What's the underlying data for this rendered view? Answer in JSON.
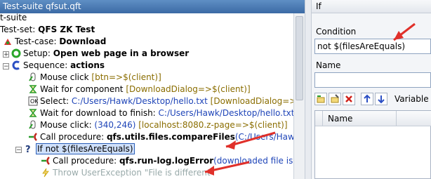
{
  "left_panel": {
    "title": "Test-suite qfsut.qft",
    "tree": [
      {
        "id": "suite",
        "text": "t-suite"
      },
      {
        "id": "set",
        "prefix": "Test-set: ",
        "bold": "QFS ZK Test"
      },
      {
        "id": "case",
        "prefix": "Test-case: ",
        "bold": "Download"
      },
      {
        "id": "setup",
        "prefix": "Setup: ",
        "bold": "Open web page in a browser"
      },
      {
        "id": "seq",
        "prefix": "Sequence: ",
        "bold": "actions"
      },
      {
        "id": "click1",
        "prefix": "Mouse click ",
        "arg": "[btn=>$(client)]"
      },
      {
        "id": "wait",
        "prefix": "Wait for component ",
        "arg": "[DownloadDialog=>$(client)]"
      },
      {
        "id": "select",
        "prefix": "Select: ",
        "arg": "C:/Users/Hawk/Desktop/hello.txt",
        "arg2": " [DownloadDialog=>$"
      },
      {
        "id": "waitdl",
        "prefix": "Wait for download to finish: ",
        "arg": "C:/Users/Hawk/Desktop/hello.txt"
      },
      {
        "id": "click2",
        "prefix": "Mouse click: ",
        "arg": "(340,246)",
        "arg2": " [localhost:8080.z-page=>$(client)]"
      },
      {
        "id": "call1",
        "prefix": "Call procedure: ",
        "bold": "qfs.utils.files.compareFiles",
        "arg": "(C:/Users/Hawk/Des"
      },
      {
        "id": "if",
        "text": "If not $(filesAreEquals)"
      },
      {
        "id": "call2",
        "prefix": "Call procedure: ",
        "bold": "qfs.run-log.logError",
        "arg": "(downloaded file is d"
      },
      {
        "id": "throw",
        "text": "Throw UserException \"File is different\""
      }
    ]
  },
  "right_panel": {
    "title": "If",
    "condition_label": "Condition",
    "condition_value": "not $(filesAreEquals)",
    "name_label": "Name",
    "name_value": "",
    "variable_label": "Variable",
    "table_header_name": "Name"
  },
  "colors": {
    "title_bar": "#3b6aa5",
    "link_blue": "#1f45b8",
    "annotation_arrow": "#e0302a",
    "selection": "#cfe0fb"
  }
}
